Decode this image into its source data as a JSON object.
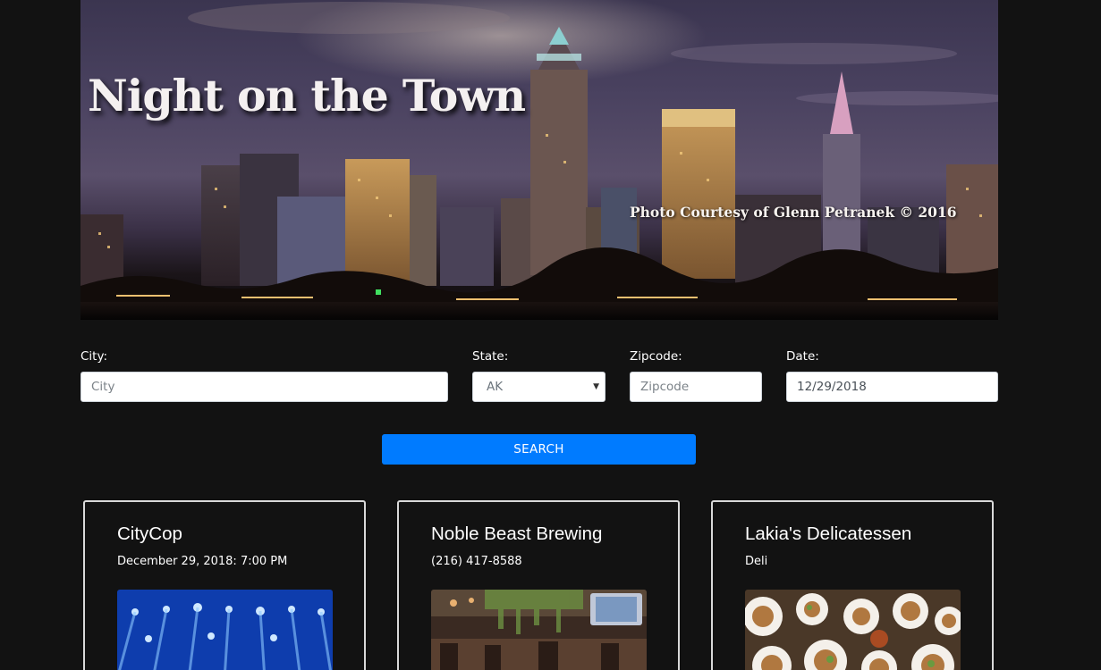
{
  "hero": {
    "title": "Night on the Town",
    "credit": "Photo Courtesy of Glenn Petranek © 2016"
  },
  "form": {
    "city": {
      "label": "City:",
      "placeholder": "City",
      "value": ""
    },
    "state": {
      "label": "State:",
      "value": "AK"
    },
    "zipcode": {
      "label": "Zipcode:",
      "placeholder": "Zipcode",
      "value": ""
    },
    "date": {
      "label": "Date:",
      "value": "12/29/2018"
    },
    "search_label": "SEARCH"
  },
  "cards": [
    {
      "title": "CityCop",
      "subtitle": "December 29, 2018: 7:00 PM",
      "image": "concert-stage-lights"
    },
    {
      "title": "Noble Beast Brewing",
      "subtitle": "(216) 417-8588",
      "image": "brewery-interior"
    },
    {
      "title": "Lakia's Delicatessen",
      "subtitle": "Deli",
      "image": "table-of-food-plates"
    }
  ],
  "colors": {
    "background": "#121212",
    "accent": "#007bff",
    "card_border": "#d9d9d9"
  }
}
